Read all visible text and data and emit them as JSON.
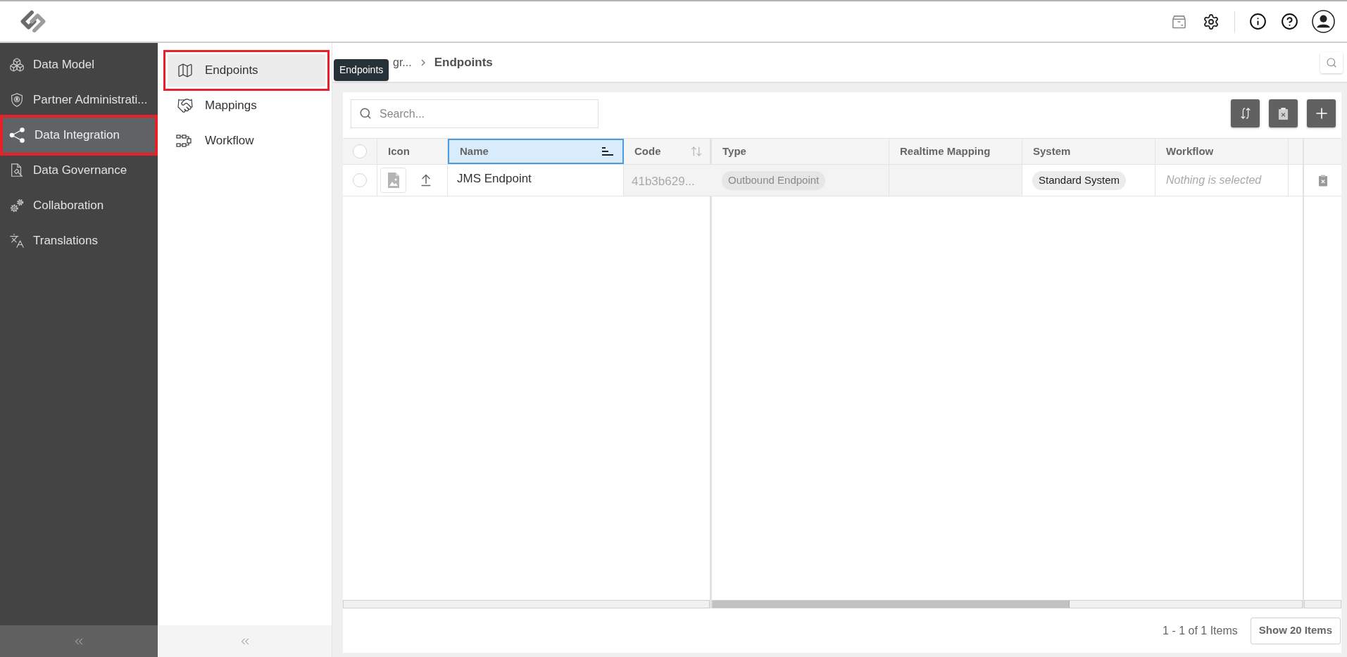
{
  "sidebar": {
    "items": [
      {
        "label": "Data Model",
        "selected": false,
        "outlined": false
      },
      {
        "label": "Partner Administrati...",
        "selected": false,
        "outlined": false
      },
      {
        "label": "Data Integration",
        "selected": true,
        "outlined": true
      },
      {
        "label": "Data Governance",
        "selected": false,
        "outlined": false
      },
      {
        "label": "Collaboration",
        "selected": false,
        "outlined": false
      },
      {
        "label": "Translations",
        "selected": false,
        "outlined": false
      }
    ]
  },
  "subnav": {
    "items": [
      {
        "label": "Endpoints",
        "selected": true,
        "outlined": true
      },
      {
        "label": "Mappings",
        "selected": false,
        "outlined": false
      },
      {
        "label": "Workflow",
        "selected": false,
        "outlined": false
      }
    ]
  },
  "tooltip": {
    "text": "Endpoints"
  },
  "breadcrumb": [
    {
      "label": "gr...",
      "current": false
    },
    {
      "label": "Endpoints",
      "current": true
    }
  ],
  "search": {
    "placeholder": "Search..."
  },
  "table": {
    "select_all": {
      "checked": false
    },
    "columns": [
      {
        "label": "Icon"
      },
      {
        "label": "Name",
        "selected": true,
        "sorted": true
      },
      {
        "label": "Code",
        "selected": false,
        "sorted": false
      },
      {
        "label": "Type"
      },
      {
        "label": "Realtime Mapping"
      },
      {
        "label": "System"
      },
      {
        "label": "Workflow"
      }
    ],
    "rows": [
      {
        "checked": false,
        "name": "JMS Endpoint",
        "code": "41b3b629...",
        "type": "Outbound Endpoint",
        "system": "Standard System",
        "workflow": {
          "placeholder": "Nothing is selected"
        }
      }
    ]
  },
  "pager": {
    "summary": "1 - 1 of 1 Items",
    "page_size": "Show 20 Items"
  }
}
